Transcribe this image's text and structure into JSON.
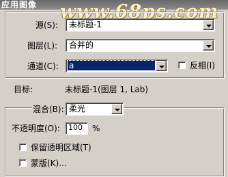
{
  "window": {
    "title": "应用图像"
  },
  "watermark": "www.68ps.com",
  "source": {
    "source_label": "源(S):",
    "source_value": "未标题-1",
    "layer_label": "图层(L):",
    "layer_value": "合并的",
    "channel_label": "通道(C):",
    "channel_value": "a",
    "invert_label": "反相(I)",
    "invert_checked": false
  },
  "target": {
    "label": "目标:",
    "value": "未标题-1(图层 1, Lab)"
  },
  "blending": {
    "blend_label": "混合(B):",
    "blend_value": "柔光",
    "opacity_label": "不透明度(O):",
    "opacity_value": "100",
    "opacity_unit": "%",
    "preserve_label": "保留透明区域(T)",
    "preserve_checked": false,
    "mask_label": "蒙版(K)...",
    "mask_checked": false
  },
  "colors": {
    "dialog_bg": "#d4d0c8",
    "selection": "#0a246a",
    "watermark": "#f7efcc"
  }
}
